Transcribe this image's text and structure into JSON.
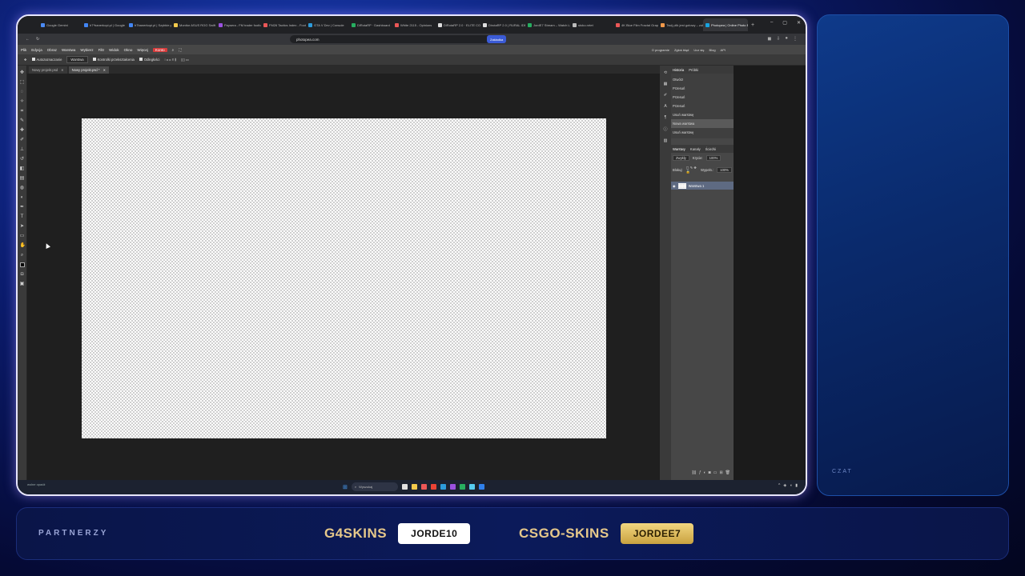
{
  "browser": {
    "tabs": [
      {
        "label": "Google Gemini",
        "color": "#4b8bf5"
      },
      {
        "label": "h7*banerkopi.pl | Google",
        "color": "#4285f4"
      },
      {
        "label": "h7banerkopi.pl | Szybkie.pl",
        "color": "#4285f4"
      },
      {
        "label": "Monitor ASUS ROG Swift P",
        "color": "#f2c94c"
      },
      {
        "label": "Paysera - FM trader football",
        "color": "#9b51e0"
      },
      {
        "label": "FM26 Tactics Index - Football",
        "color": "#eb5757"
      },
      {
        "label": "GTA V Dev | Console",
        "color": "#2d9cdb"
      },
      {
        "label": "DiRotaRP · Dashboard",
        "color": "#27ae60"
      },
      {
        "label": "White 2115 - Opinions",
        "color": "#eb5757"
      },
      {
        "label": "DiRotaRP 2.0 · ELITE CONTENT",
        "color": "#ddd"
      },
      {
        "label": "DirotaRP 2.0 | RURAL IDE",
        "color": "#ddd"
      },
      {
        "label": "JordE7 Stream – Watch Live",
        "color": "#27ae60"
      },
      {
        "label": "stoko.nrtet",
        "color": "#bbb"
      },
      {
        "label": "4K Blue Film Fractal Graphic",
        "color": "#eb5757"
      },
      {
        "label": "Twój plik jest gotowy – zobacz",
        "color": "#f2994a"
      },
      {
        "label": "Photopea | Online Photo Editor",
        "color": "#18a3e0"
      }
    ],
    "active_tab_index": 15,
    "url": "photopea.com",
    "bookmark_label": "Zakładka",
    "window_controls": [
      "–",
      "▢",
      "✕"
    ]
  },
  "photopea": {
    "menu": [
      "Plik",
      "Edycja",
      "Obraz",
      "Warstwa",
      "Wybierz",
      "Filtr",
      "Widok",
      "Okno",
      "Więcej"
    ],
    "menu_highlight": "Konto",
    "right_links": [
      "O programie",
      "Zgłoś błąd",
      "Ucz się",
      "Blog",
      "API"
    ],
    "tool_options": {
      "autoselect_label": "Autozaznaczanie",
      "autoselect_value": "Warstwa",
      "transform_label": "Kontrolki przekształcenia",
      "distances_label": "Odległości"
    },
    "document_tabs": [
      {
        "label": "Nowy projekt.psd",
        "close": "✕"
      },
      {
        "label": "Nowy projekt.psd *",
        "close": "✕"
      }
    ],
    "panel_tabs_top": [
      "Historia",
      "Próbki"
    ],
    "history_items": [
      "Otwórz",
      "Przesuń",
      "Przesuń",
      "Przesuń",
      "Usuń warstwę",
      "Nowa warstwa",
      "Usuń warstwę"
    ],
    "history_selected_index": 5,
    "panel_tabs_layers": [
      "Warstwy",
      "Kanały",
      "Ścieżki"
    ],
    "blend_mode": "Zwykły",
    "opacity_label": "Krycie:",
    "opacity_value": "100%",
    "lock_label": "Blokuj:",
    "fill_label": "Wypełn.:",
    "fill_value": "100%",
    "layer_name": "Warstwa 1"
  },
  "taskbar": {
    "left_text": "wolne opadż",
    "search_placeholder": "Wyszukaj",
    "app_icon_colors": [
      "#e0e0e0",
      "#f2c94c",
      "#eb5757",
      "#ea4335",
      "#2d9cdb",
      "#9b51e0",
      "#27ae60",
      "#56ccf2",
      "#2f80ed"
    ]
  },
  "overlay": {
    "chat_label": "CZAT",
    "partners_label": "PARTNERZY",
    "sponsors": [
      {
        "name": "G4SKINS",
        "code": "JORDE10"
      },
      {
        "name": "CSGO-SKINS",
        "code": "JORDEE7"
      }
    ]
  }
}
